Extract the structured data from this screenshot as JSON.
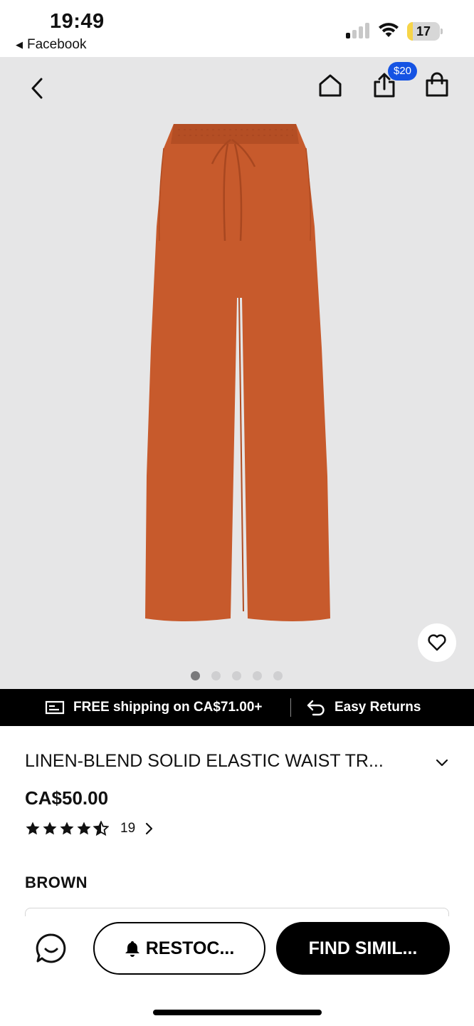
{
  "status_bar": {
    "time": "19:49",
    "back_app": "Facebook",
    "battery_level": "17",
    "battery_fraction": 0.17,
    "signal_bars_active": 1,
    "signal_bars_total": 4
  },
  "hero": {
    "share_badge": "$20",
    "carousel_total": 5,
    "carousel_active_index": 0,
    "product_color_hex": "#c75a2c",
    "background_hex": "#e6e6e7"
  },
  "banner": {
    "shipping_text": "FREE shipping on CA$71.00+",
    "returns_text": "Easy Returns"
  },
  "product": {
    "title": "LINEN-BLEND SOLID ELASTIC WAIST TR...",
    "price": "CA$50.00",
    "rating_value": 4.5,
    "rating_max": 5,
    "review_count": "19",
    "color_label": "BROWN"
  },
  "actions": {
    "restock_label": "RESTOC...",
    "find_similar_label": "FIND SIMIL..."
  },
  "colors": {
    "badge_blue": "#1553e3",
    "battery_yellow": "#f7d548",
    "banner_black": "#000000"
  }
}
